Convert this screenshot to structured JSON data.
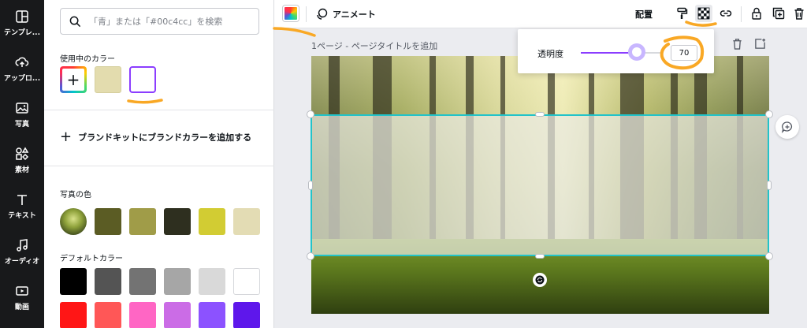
{
  "rail": {
    "items": [
      {
        "label": "テンプレ...",
        "icon": "template-icon"
      },
      {
        "label": "アップロ...",
        "icon": "upload-icon"
      },
      {
        "label": "写真",
        "icon": "photo-icon"
      },
      {
        "label": "素材",
        "icon": "elements-icon"
      },
      {
        "label": "テキスト",
        "icon": "text-icon"
      },
      {
        "label": "オーディオ",
        "icon": "audio-icon"
      },
      {
        "label": "動画",
        "icon": "video-icon"
      }
    ]
  },
  "panel": {
    "search_placeholder": "「青」または「#00c4cc」を検索",
    "in_use_title": "使用中のカラー",
    "in_use_colors": [
      "#e3dcae",
      "#ffffff"
    ],
    "brand_kit_label": "ブランドキットにブランドカラーを追加する",
    "photo_colors_title": "写真の色",
    "photo_colors": [
      "#5b5c24",
      "#a09c48",
      "#2e2f1f",
      "#d2cc33",
      "#e3dcb4"
    ],
    "default_colors_title": "デフォルトカラー",
    "default_colors_row1": [
      "#000000",
      "#545454",
      "#737373",
      "#a6a6a6",
      "#d9d9d9",
      "#ffffff"
    ],
    "default_colors_row2": [
      "#ff1616",
      "#ff5757",
      "#ff66c4",
      "#cb6ce6",
      "#8c52ff",
      "#5e17eb"
    ]
  },
  "toolbar": {
    "animate_label": "アニメート",
    "arrange_label": "配置",
    "accent_color": "#8b3dff"
  },
  "canvas": {
    "page_title": "1ページ - ページタイトルを追加"
  },
  "transparency": {
    "label": "透明度",
    "value": "70",
    "fraction": 0.7
  }
}
